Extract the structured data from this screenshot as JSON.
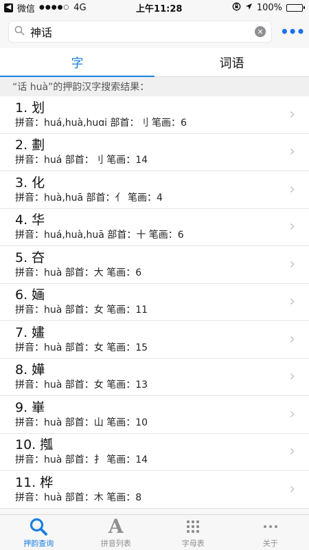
{
  "status_bar": {
    "carrier": "微信",
    "signal": "●●●●○",
    "network": "4G",
    "time": "上午11:28",
    "battery": "100%"
  },
  "search": {
    "value": "神话",
    "placeholder": "",
    "more_label": "•••"
  },
  "tabs": [
    {
      "label": "字",
      "active": true
    },
    {
      "label": "词语",
      "active": false
    }
  ],
  "section_header": "“话 huà”的押韵汉字搜索结果：",
  "items": [
    {
      "title": "1. 划",
      "sub": "拼音：huá,huà,huɑi  部首：刂  笔画：6"
    },
    {
      "title": "2. 劃",
      "sub": "拼音：huá  部首：刂  笔画：14"
    },
    {
      "title": "3. 化",
      "sub": "拼音：huà,huā  部首：亻  笔画：4"
    },
    {
      "title": "4. 华",
      "sub": "拼音：huá,huà,huā  部首：十  笔画：6"
    },
    {
      "title": "5. 夻",
      "sub": "拼音：huà  部首：大  笔画：6"
    },
    {
      "title": "6. 婳",
      "sub": "拼音：huà  部首：女  笔画：11"
    },
    {
      "title": "7. 嫿",
      "sub": "拼音：huà  部首：女  笔画：15"
    },
    {
      "title": "8. 嬅",
      "sub": "拼音：huà  部首：女  笔画：13"
    },
    {
      "title": "9. 崋",
      "sub": "拼音：huà  部首：山  笔画：10"
    },
    {
      "title": "10. 摦",
      "sub": "拼音：huà  部首：扌  笔画：14"
    },
    {
      "title": "11. 桦",
      "sub": "拼音：huà  部首：木  笔画：8"
    }
  ],
  "tabbar": [
    {
      "label": "押韵查询",
      "icon": "search-icon",
      "active": true
    },
    {
      "label": "拼音列表",
      "icon": "letter-a-icon",
      "active": false
    },
    {
      "label": "字母表",
      "icon": "grid-icon",
      "active": false
    },
    {
      "label": "关于",
      "icon": "more-icon",
      "active": false
    }
  ],
  "colors": {
    "accent": "#1a7fe0",
    "battery": "#3ec43e"
  }
}
